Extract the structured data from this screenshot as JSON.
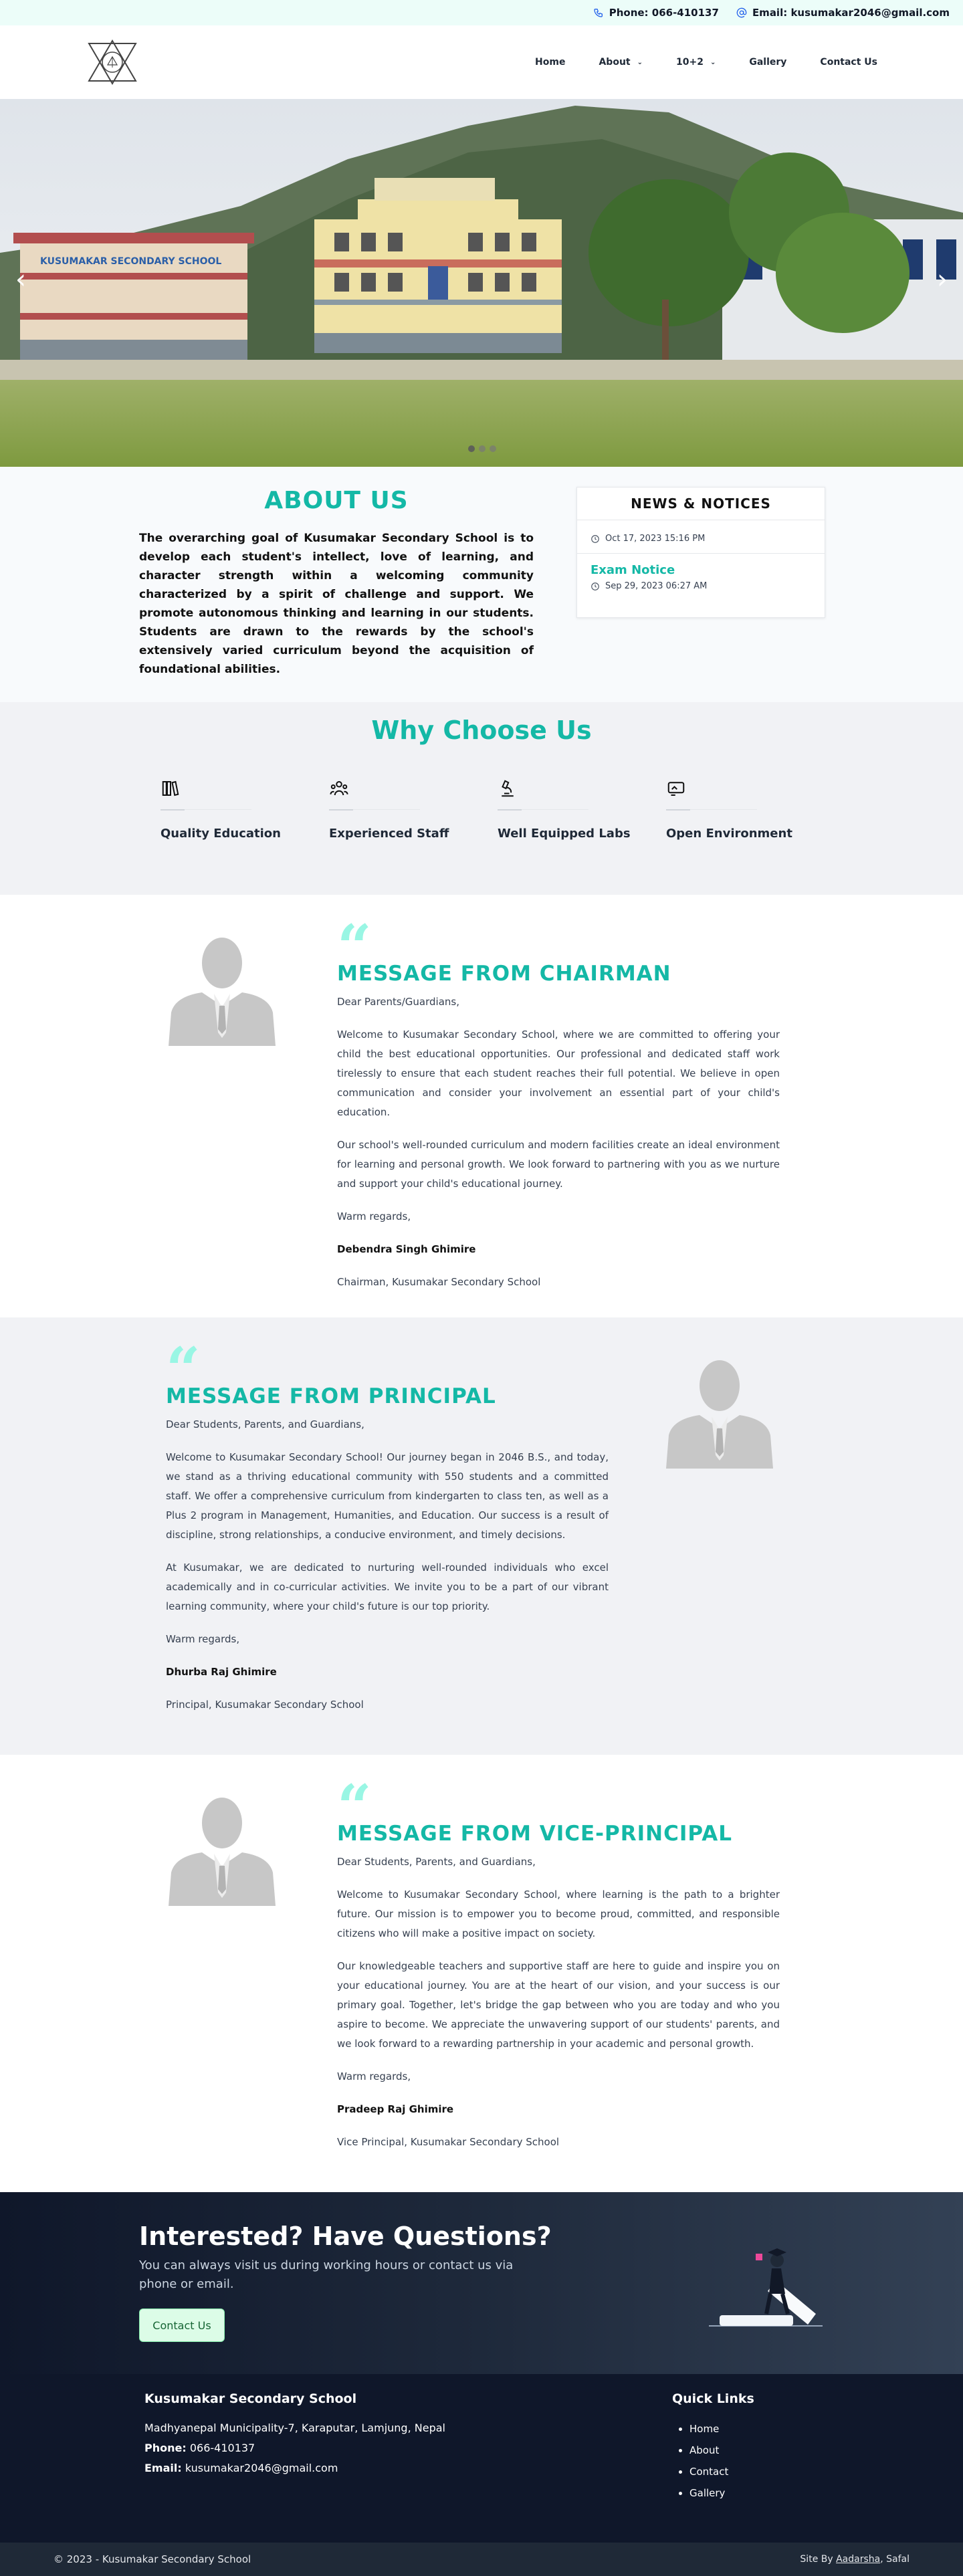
{
  "topbar": {
    "phone": "Phone: 066-410137",
    "email": "Email: kusumakar2046@gmail.com"
  },
  "nav": {
    "items": [
      "Home",
      "About",
      "10+2",
      "Gallery",
      "Contact Us"
    ]
  },
  "hero": {
    "sign_text": "KUSUMAKAR SECONDARY SCHOOL"
  },
  "about": {
    "title": "ABOUT US",
    "body": "The overarching goal of Kusumakar Secondary School is to develop each student's intellect, love of learning, and character strength within a welcoming community characterized by a spirit of challenge and support. We promote autonomous thinking and learning in our students. Students are drawn to the rewards by the school's extensively varied curriculum beyond the acquisition of foundational abilities."
  },
  "news": {
    "title": "NEWS & NOTICES",
    "items": [
      {
        "title": "",
        "date": "Oct 17, 2023 15:16 PM"
      },
      {
        "title": "Exam Notice",
        "date": "Sep 29, 2023 06:27 AM"
      }
    ]
  },
  "why": {
    "title": "Why Choose Us",
    "features": [
      {
        "label": "Quality Education",
        "icon": "books-icon"
      },
      {
        "label": "Experienced Staff",
        "icon": "users-icon"
      },
      {
        "label": "Well Equipped Labs",
        "icon": "microscope-icon"
      },
      {
        "label": "Open Environment",
        "icon": "screen-icon"
      }
    ]
  },
  "chairman": {
    "title": "MESSAGE FROM CHAIRMAN",
    "greeting": "Dear Parents/Guardians,",
    "p1": "Welcome to Kusumakar Secondary School, where we are committed to offering your child the best educational opportunities. Our professional and dedicated staff work tirelessly to ensure that each student reaches their full potential. We believe in open communication and consider your involvement an essential part of your child's education.",
    "p2": "Our school's well-rounded curriculum and modern facilities create an ideal environment for learning and personal growth. We look forward to partnering with you as we nurture and support your child's educational journey.",
    "regards": "Warm regards,",
    "name": "Debendra Singh Ghimire",
    "role": "Chairman, Kusumakar Secondary School"
  },
  "principal": {
    "title": "MESSAGE FROM PRINCIPAL",
    "greeting": "Dear Students, Parents, and Guardians,",
    "p1": "Welcome to Kusumakar Secondary School! Our journey began in 2046 B.S., and today, we stand as a thriving educational community with 550 students and a committed staff. We offer a comprehensive curriculum from kindergarten to class ten, as well as a Plus 2 program in Management, Humanities, and Education. Our success is a result of discipline, strong relationships, a conducive environment, and timely decisions.",
    "p2": "At Kusumakar, we are dedicated to nurturing well-rounded individuals who excel academically and in co-curricular activities. We invite you to be a part of our vibrant learning community, where your child's future is our top priority.",
    "regards": "Warm regards,",
    "name": "Dhurba Raj Ghimire",
    "role": "Principal, Kusumakar Secondary School"
  },
  "vice": {
    "title": "MESSAGE FROM VICE-PRINCIPAL",
    "greeting": "Dear Students, Parents, and Guardians,",
    "p1": "Welcome to Kusumakar Secondary School, where learning is the path to a brighter future. Our mission is to empower you to become proud, committed, and responsible citizens who will make a positive impact on society.",
    "p2": "Our knowledgeable teachers and supportive staff are here to guide and inspire you on your educational journey. You are at the heart of our vision, and your success is our primary goal. Together, let's bridge the gap between who you are today and who you aspire to become. We appreciate the unwavering support of our students' parents, and we look forward to a rewarding partnership in your academic and personal growth.",
    "regards": "Warm regards,",
    "name": "Pradeep Raj Ghimire",
    "role": "Vice Principal, Kusumakar Secondary School"
  },
  "cta": {
    "title": "Interested? Have Questions?",
    "body": "You can always visit us during working hours or contact us via phone or email.",
    "button": "Contact Us"
  },
  "footer": {
    "name": "Kusumakar Secondary School",
    "address": "Madhyanepal Municipality-7, Karaputar, Lamjung, Nepal",
    "phone_label": "Phone:",
    "phone": "066-410137",
    "email_label": "Email:",
    "email": "kusumakar2046@gmail.com",
    "links_title": "Quick Links",
    "links": [
      "Home",
      "About",
      "Contact",
      "Gallery"
    ]
  },
  "bottom": {
    "copyright": "© 2023 - Kusumakar Secondary School",
    "site_by": "Site By",
    "author1": "Aadarsha",
    "sep": ", ",
    "author2": "Safal"
  },
  "colors": {
    "accent": "#14b8a6",
    "dark": "#0f172a"
  }
}
